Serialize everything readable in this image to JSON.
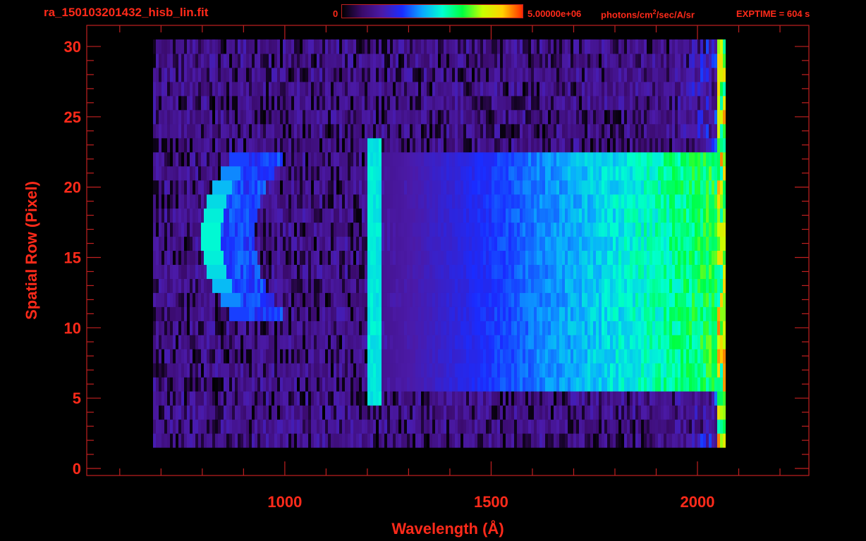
{
  "header": {
    "file_title": "ra_150103201432_hisb_lin.fit",
    "colorbar_min": "0",
    "colorbar_max": "5.00000e+06",
    "colorbar_units": "photons/cm",
    "colorbar_units_sup": "2",
    "colorbar_units_tail": "/sec/A/sr",
    "exptime": "EXPTIME = 604 s"
  },
  "colors": {
    "axis": "#ff2a1a",
    "background": "#000000",
    "colormap": [
      "#000000",
      "#3a0a6a",
      "#4b1aa8",
      "#1a2cff",
      "#0aa8ff",
      "#00ffd0",
      "#00ff40",
      "#c8ff00",
      "#ffd000",
      "#ff2a00"
    ]
  },
  "chart_data": {
    "type": "heatmap",
    "title": "ra_150103201432_hisb_lin.fit",
    "xlabel": "Wavelength (Å)",
    "ylabel": "Spatial Row (Pixel)",
    "xlim": [
      520,
      2270
    ],
    "ylim": [
      -0.5,
      31.5
    ],
    "x_ticks": [
      1000,
      1500,
      2000
    ],
    "y_ticks": [
      0,
      5,
      10,
      15,
      20,
      25,
      30
    ],
    "grid": false,
    "colorbar": {
      "min": 0,
      "max": 5000000,
      "units": "photons/cm^2/sec/A/sr"
    },
    "data_extent": {
      "x": [
        680,
        2065
      ],
      "rows": [
        2,
        30
      ]
    },
    "features": [
      {
        "name": "continuum",
        "x": [
          1230,
          2065
        ],
        "rows": [
          6,
          22
        ],
        "peak_level": 0.55
      },
      {
        "name": "vertical line",
        "x": [
          1195,
          1230
        ],
        "rows": [
          5,
          23
        ],
        "peak_level": 0.5
      },
      {
        "name": "arc",
        "x": [
          795,
          960
        ],
        "rows": [
          11,
          22
        ],
        "peak_level": 0.55
      }
    ]
  }
}
